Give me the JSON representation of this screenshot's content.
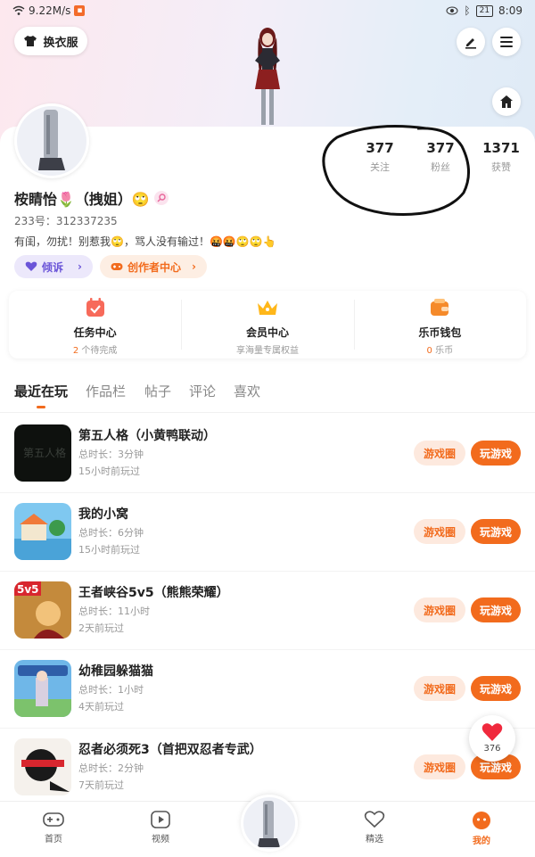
{
  "status_bar": {
    "speed": "9.22M/s",
    "battery": "21",
    "time": "8:09"
  },
  "header": {
    "outfit_label": "换衣服"
  },
  "stats": [
    {
      "value": "377",
      "label": "关注"
    },
    {
      "value": "377",
      "label": "粉丝"
    },
    {
      "value": "1371",
      "label": "获赞"
    }
  ],
  "profile": {
    "nickname": "桉睛怡🌷（拽姐）🙄",
    "uid": "233号：312337235",
    "bio": "有闺，勿扰！别惹我🙄，骂人没有输过！🤬🤬🙄🙄👆"
  },
  "pills": {
    "complain": "倾诉",
    "creator": "创作者中心"
  },
  "quick": [
    {
      "title": "任务中心",
      "sub_highlight": "2",
      "sub": " 个待完成",
      "icon": "task-calendar-icon"
    },
    {
      "title": "会员中心",
      "sub_highlight": "",
      "sub": "享海量专属权益",
      "icon": "crown-icon"
    },
    {
      "title": "乐币钱包",
      "sub_highlight": "0",
      "sub": " 乐币",
      "icon": "wallet-icon"
    }
  ],
  "tabs": [
    "最近在玩",
    "作品栏",
    "帖子",
    "评论",
    "喜欢"
  ],
  "game_buttons": {
    "circle": "游戏圈",
    "play": "玩游戏"
  },
  "games": [
    {
      "name": "第五人格（小黄鸭联动）",
      "duration": "总时长：3分钟",
      "last_played": "15小时前玩过"
    },
    {
      "name": "我的小窝",
      "duration": "总时长：6分钟",
      "last_played": "15小时前玩过"
    },
    {
      "name": "王者峡谷5v5（熊熊荣耀）",
      "duration": "总时长：11小时",
      "last_played": "2天前玩过"
    },
    {
      "name": "幼稚园躲猫猫",
      "duration": "总时长：1小时",
      "last_played": "4天前玩过"
    },
    {
      "name": "忍者必须死3（首把双忍者专武）",
      "duration": "总时长：2分钟",
      "last_played": "7天前玩过"
    }
  ],
  "like_float": {
    "count": "376"
  },
  "nav": [
    "首页",
    "视频",
    "精选",
    "我的"
  ],
  "colors": {
    "accent": "#f26b1d",
    "purple": "#6b55d8"
  }
}
